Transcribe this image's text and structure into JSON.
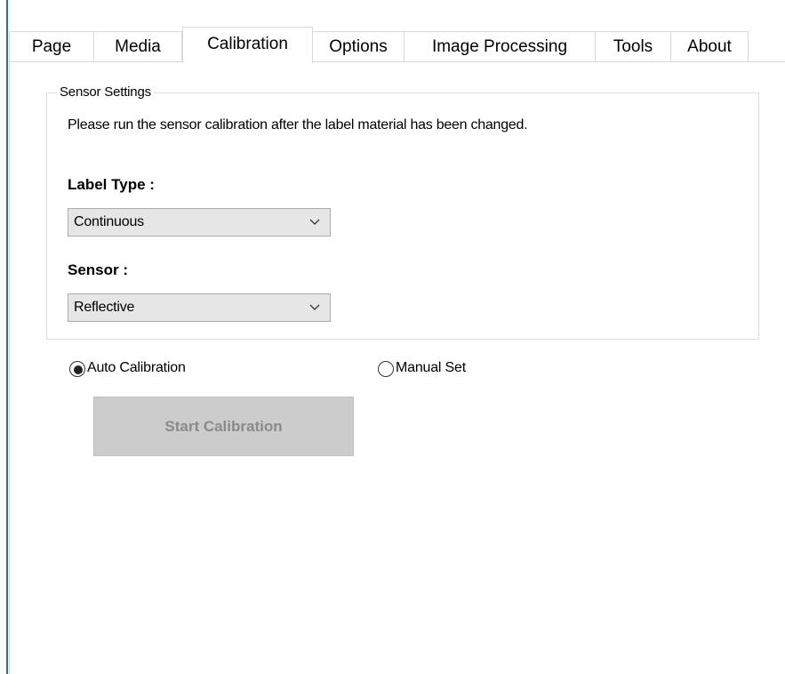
{
  "tabs": [
    {
      "label": "Page",
      "active": false
    },
    {
      "label": "Media",
      "active": false
    },
    {
      "label": "Calibration",
      "active": true
    },
    {
      "label": "Options",
      "active": false
    },
    {
      "label": "Image Processing",
      "active": false
    },
    {
      "label": "Tools",
      "active": false
    },
    {
      "label": "About",
      "active": false
    }
  ],
  "sensor_settings": {
    "group_title": "Sensor Settings",
    "hint": "Please run the sensor calibration after the label material has been changed.",
    "label_type": {
      "label": "Label Type :",
      "selected": "Continuous",
      "icon": "chevron-down-icon"
    },
    "sensor": {
      "label": "Sensor :",
      "selected": "Reflective",
      "icon": "chevron-down-icon"
    }
  },
  "calibration_mode": {
    "auto": {
      "label": "Auto Calibration",
      "checked": true
    },
    "manual": {
      "label": "Manual Set",
      "checked": false
    }
  },
  "start_button": {
    "label": "Start Calibration",
    "enabled": false
  },
  "colors": {
    "window_edge": "#1f6fb8",
    "disabled_button_bg": "#cccccc",
    "disabled_button_text": "#8a8a8a",
    "combo_bg": "#e6e6e6"
  }
}
